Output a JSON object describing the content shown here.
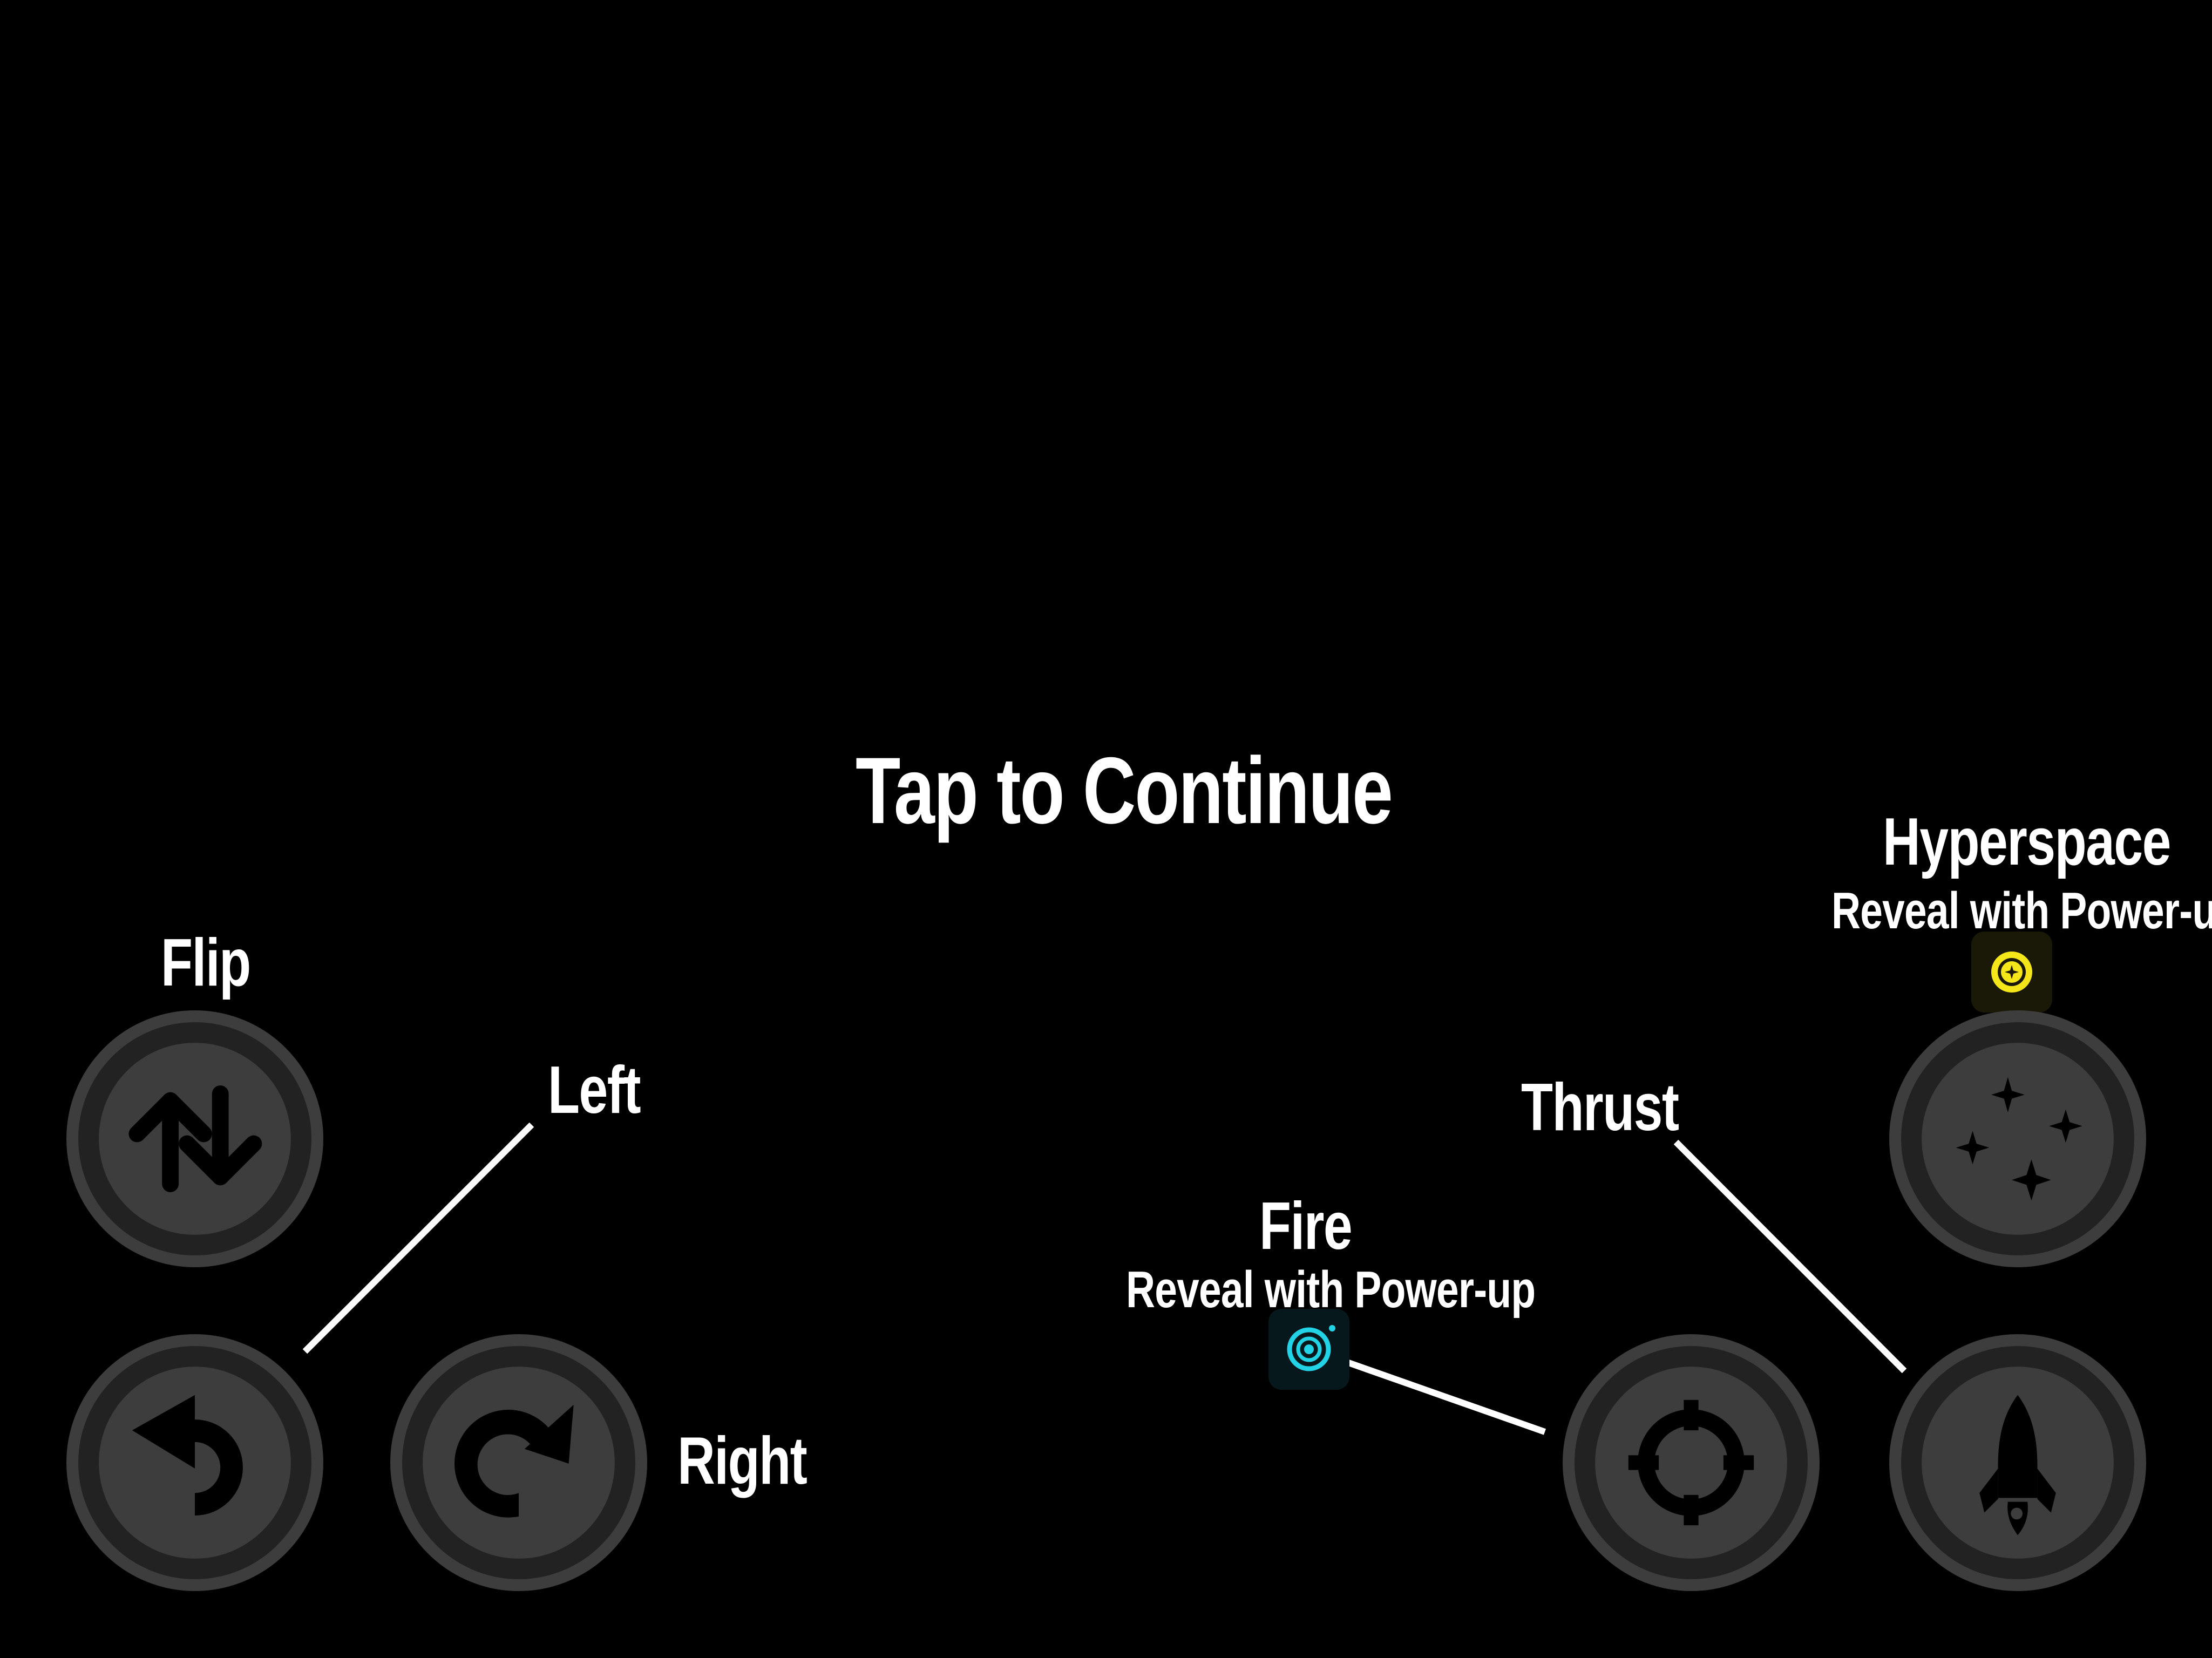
{
  "prompt": {
    "tap_to_continue": "Tap to Continue"
  },
  "controls": {
    "flip": {
      "label": "Flip",
      "icon": "flip-arrows-icon"
    },
    "left": {
      "label": "Left",
      "icon": "rotate-left-icon"
    },
    "right": {
      "label": "Right",
      "icon": "rotate-right-icon"
    },
    "fire": {
      "label": "Fire",
      "note": "Reveal with Power-up",
      "icon": "crosshair-icon",
      "powerup_icon": "fire-powerup-icon"
    },
    "thrust": {
      "label": "Thrust",
      "icon": "rocket-icon"
    },
    "hyperspace": {
      "label": "Hyperspace",
      "note": "Reveal with Power-up",
      "icon": "sparkles-icon",
      "powerup_icon": "hyperspace-powerup-icon"
    }
  },
  "colors": {
    "background": "#000000",
    "button_ring": "#3d3d3d",
    "button_fill": "#222222",
    "text": "#ffffff",
    "fire_powerup": "#22d3e6",
    "hyperspace_powerup": "#f5e61a"
  }
}
